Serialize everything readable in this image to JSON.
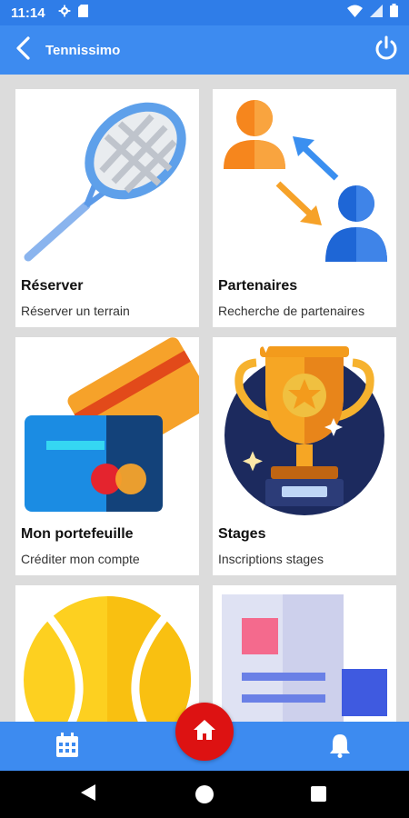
{
  "status_bar": {
    "time": "11:14",
    "icons": [
      "settings-gear-icon",
      "sd-card-icon",
      "wifi-icon",
      "signal-icon",
      "battery-icon"
    ]
  },
  "app_bar": {
    "title": "Tennissimo",
    "back_icon": "chevron-left-icon",
    "power_icon": "power-icon"
  },
  "cards": [
    {
      "title": "Réserver",
      "subtitle": "Réserver un terrain",
      "icon": "tennis-racket-icon"
    },
    {
      "title": "Partenaires",
      "subtitle": "Recherche de partenaires",
      "icon": "partners-exchange-icon"
    },
    {
      "title": "Mon portefeuille",
      "subtitle": " Créditer mon compte",
      "icon": "credit-card-icon"
    },
    {
      "title": "Stages",
      "subtitle": "Inscriptions stages",
      "icon": "trophy-icon"
    },
    {
      "title": "",
      "subtitle": "",
      "icon": "tennis-ball-icon"
    },
    {
      "title": "",
      "subtitle": "",
      "icon": "document-icon"
    }
  ],
  "bottom_bar": {
    "left_icon": "calendar-icon",
    "center_icon": "home-icon",
    "right_icon": "bell-icon"
  },
  "colors": {
    "primary": "#3d8bf0",
    "status_bar": "#2f7de8",
    "fab": "#dd1212",
    "background": "#dcdcdc"
  }
}
